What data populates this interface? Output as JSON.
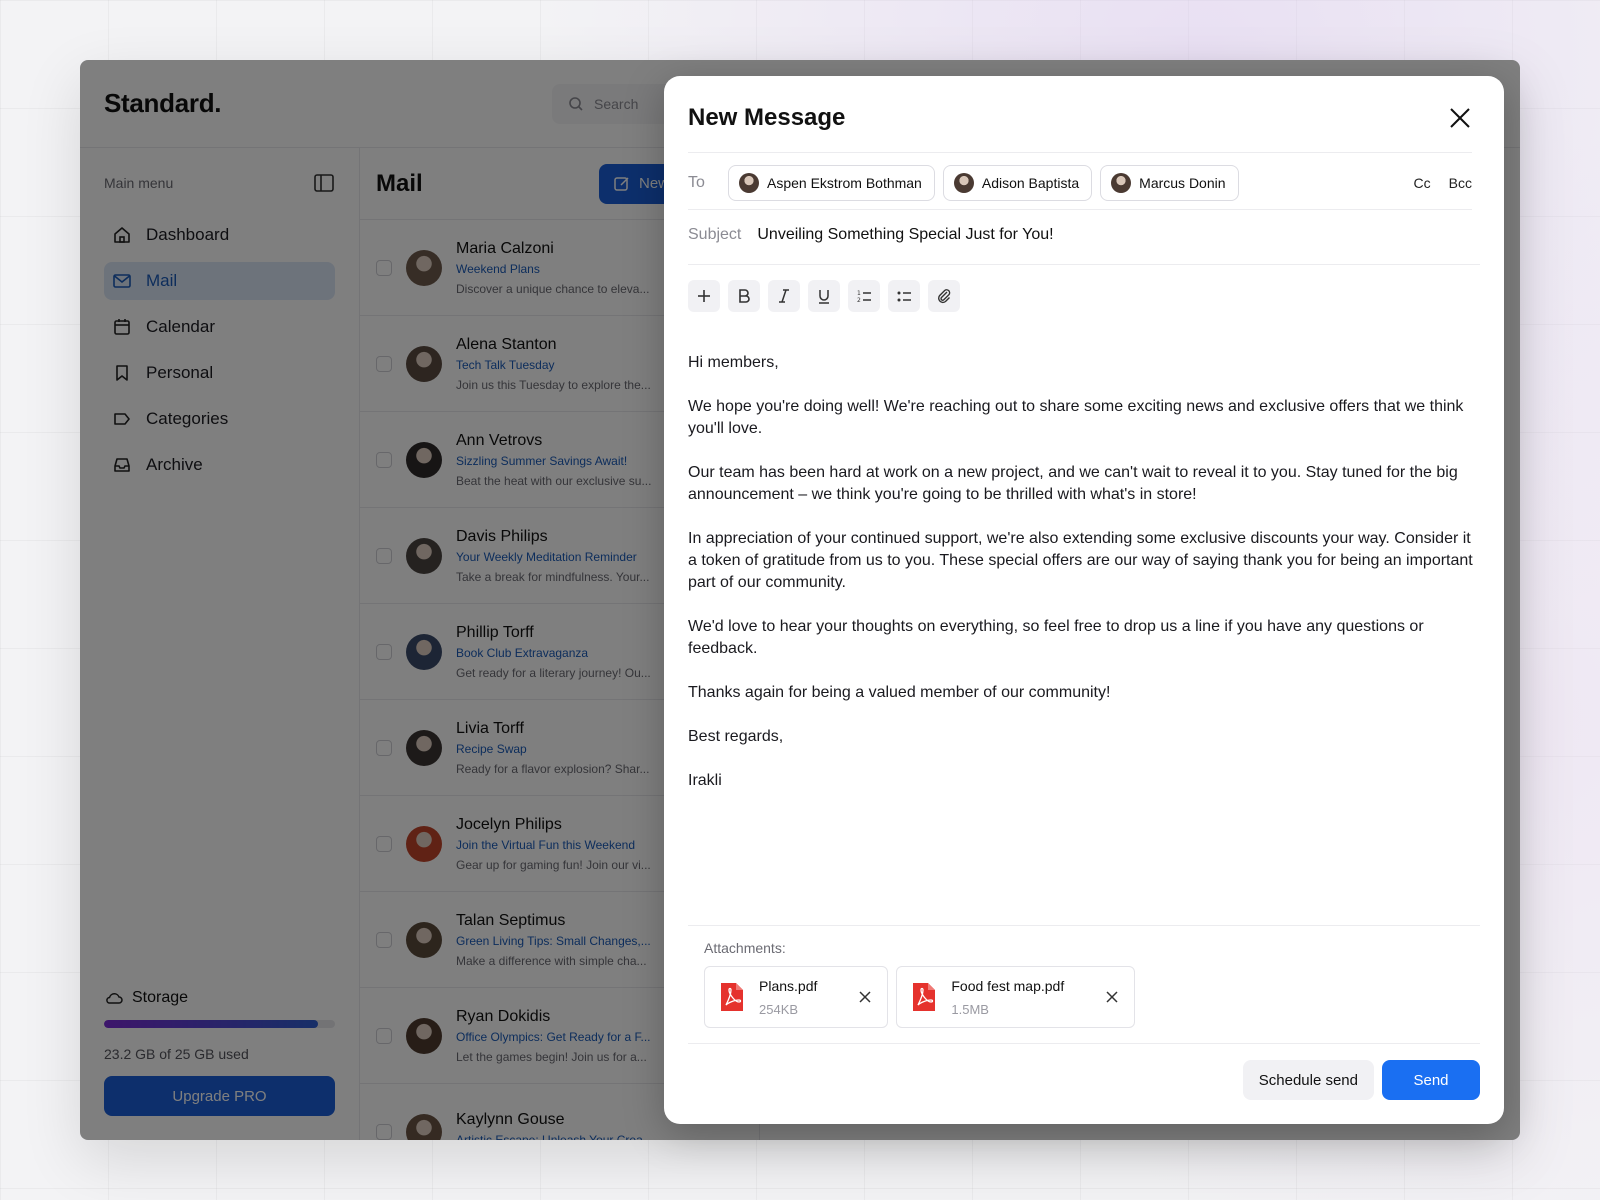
{
  "app": {
    "logo": "Standard.",
    "search_placeholder": "Search"
  },
  "sidebar": {
    "header": "Main menu",
    "items": [
      {
        "label": "Dashboard",
        "icon": "home-icon"
      },
      {
        "label": "Mail",
        "icon": "mail-icon",
        "active": true
      },
      {
        "label": "Calendar",
        "icon": "calendar-icon"
      },
      {
        "label": "Personal",
        "icon": "bookmark-icon"
      },
      {
        "label": "Categories",
        "icon": "tag-icon"
      },
      {
        "label": "Archive",
        "icon": "archive-icon"
      }
    ],
    "storage": {
      "label": "Storage",
      "used_text": "23.2 GB of 25 GB used",
      "used_fraction": 0.928,
      "upgrade_label": "Upgrade PRO"
    }
  },
  "mail": {
    "title": "Mail",
    "new_label": "New",
    "rows": [
      {
        "name": "Maria Calzoni",
        "subject": "Weekend Plans",
        "preview": "Discover a unique chance to eleva..."
      },
      {
        "name": "Alena Stanton",
        "subject": "Tech Talk Tuesday",
        "preview": "Join us this Tuesday to explore the..."
      },
      {
        "name": "Ann Vetrovs",
        "subject": "Sizzling Summer Savings Await!",
        "preview": "Beat the heat with our exclusive su..."
      },
      {
        "name": "Davis Philips",
        "subject": "Your Weekly Meditation Reminder",
        "preview": "Take a break for mindfulness. Your..."
      },
      {
        "name": "Phillip Torff",
        "subject": "Book Club Extravaganza",
        "preview": "Get ready for a literary journey! Ou..."
      },
      {
        "name": "Livia Torff",
        "subject": "Recipe Swap",
        "preview": "Ready for a flavor explosion? Shar..."
      },
      {
        "name": "Jocelyn Philips",
        "subject": "Join the Virtual Fun this Weekend",
        "preview": "Gear up for gaming fun! Join our vi..."
      },
      {
        "name": "Talan Septimus",
        "subject": "Green Living Tips: Small Changes,...",
        "preview": "Make a difference with simple cha..."
      },
      {
        "name": "Ryan Dokidis",
        "subject": "Office Olympics: Get Ready for a F...",
        "preview": "Let the games begin! Join us for a..."
      },
      {
        "name": "Kaylynn Gouse",
        "subject": "Artistic Escape: Unleash Your Crea...",
        "preview": ""
      }
    ]
  },
  "compose": {
    "title": "New Message",
    "to_label": "To",
    "recipients": [
      "Aspen Ekstrom Bothman",
      "Adison Baptista",
      "Marcus Donin"
    ],
    "cc_label": "Cc",
    "bcc_label": "Bcc",
    "subject_label": "Subject",
    "subject_value": "Unveiling Something Special Just for You!",
    "body": [
      "Hi members,",
      "We hope you're doing well! We're reaching out to share some exciting news and exclusive offers that we think you'll love.",
      "Our team has been hard at work on a new project, and we can't wait to reveal it to you. Stay tuned for the big announcement – we think you're going to be thrilled with what's in store!",
      "In appreciation of your continued support, we're also extending some exclusive discounts your way. Consider it a token of gratitude from us to you. These special offers are our way of saying thank you for being an important part of our community.",
      "We'd love to hear your thoughts on everything, so feel free to drop us a line if you have any questions or feedback.",
      "Thanks again for being a valued member of our community!",
      "Best regards,",
      "Irakli"
    ],
    "attachments_label": "Attachments:",
    "attachments": [
      {
        "name": "Plans.pdf",
        "size": "254KB"
      },
      {
        "name": "Food fest map.pdf",
        "size": "1.5MB"
      }
    ],
    "schedule_label": "Schedule send",
    "send_label": "Send"
  },
  "colors": {
    "accent": "#1a6ff2",
    "link": "#1a5bb8",
    "pdf": "#e5322d"
  }
}
